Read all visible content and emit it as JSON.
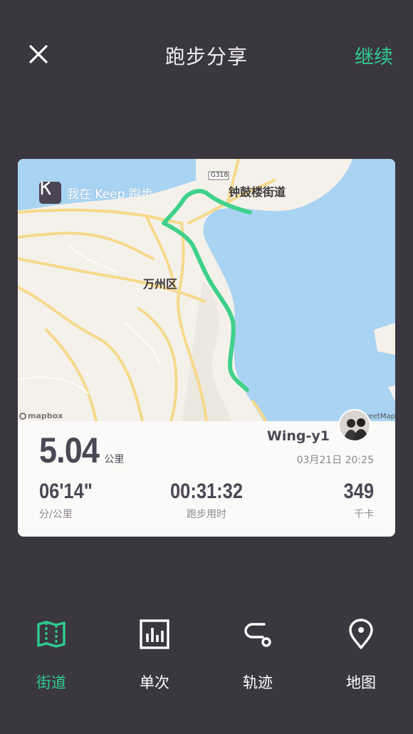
{
  "header": {
    "title": "跑步分享",
    "continue_label": "继续",
    "close_icon": "close-icon"
  },
  "colors": {
    "background": "#3b3741",
    "accent": "#2ecc8f",
    "card_text": "#4c4755",
    "route": "#3fd18a",
    "water": "#a9d3f2"
  },
  "card": {
    "badge_text": "我在 Keep 跑步",
    "map_labels": {
      "district": "万州区",
      "street": "钟鼓楼街道",
      "road_code": "G318"
    },
    "map_attribution": "mapbox",
    "osm_attribution": "StreetMap",
    "distance_value": "5.04",
    "distance_unit": "公里",
    "username": "Wing-y1",
    "datetime": "03月21日 20:25",
    "stats": [
      {
        "value": "06'14\"",
        "label": "分/公里"
      },
      {
        "value": "00:31:32",
        "label": "跑步用时"
      },
      {
        "value": "349",
        "label": "千卡"
      }
    ]
  },
  "bottom_nav": {
    "items": [
      {
        "label": "街道",
        "icon": "street-map-icon",
        "active": true
      },
      {
        "label": "单次",
        "icon": "bar-chart-icon",
        "active": false
      },
      {
        "label": "轨迹",
        "icon": "route-icon",
        "active": false
      },
      {
        "label": "地图",
        "icon": "location-pin-icon",
        "active": false
      }
    ]
  }
}
